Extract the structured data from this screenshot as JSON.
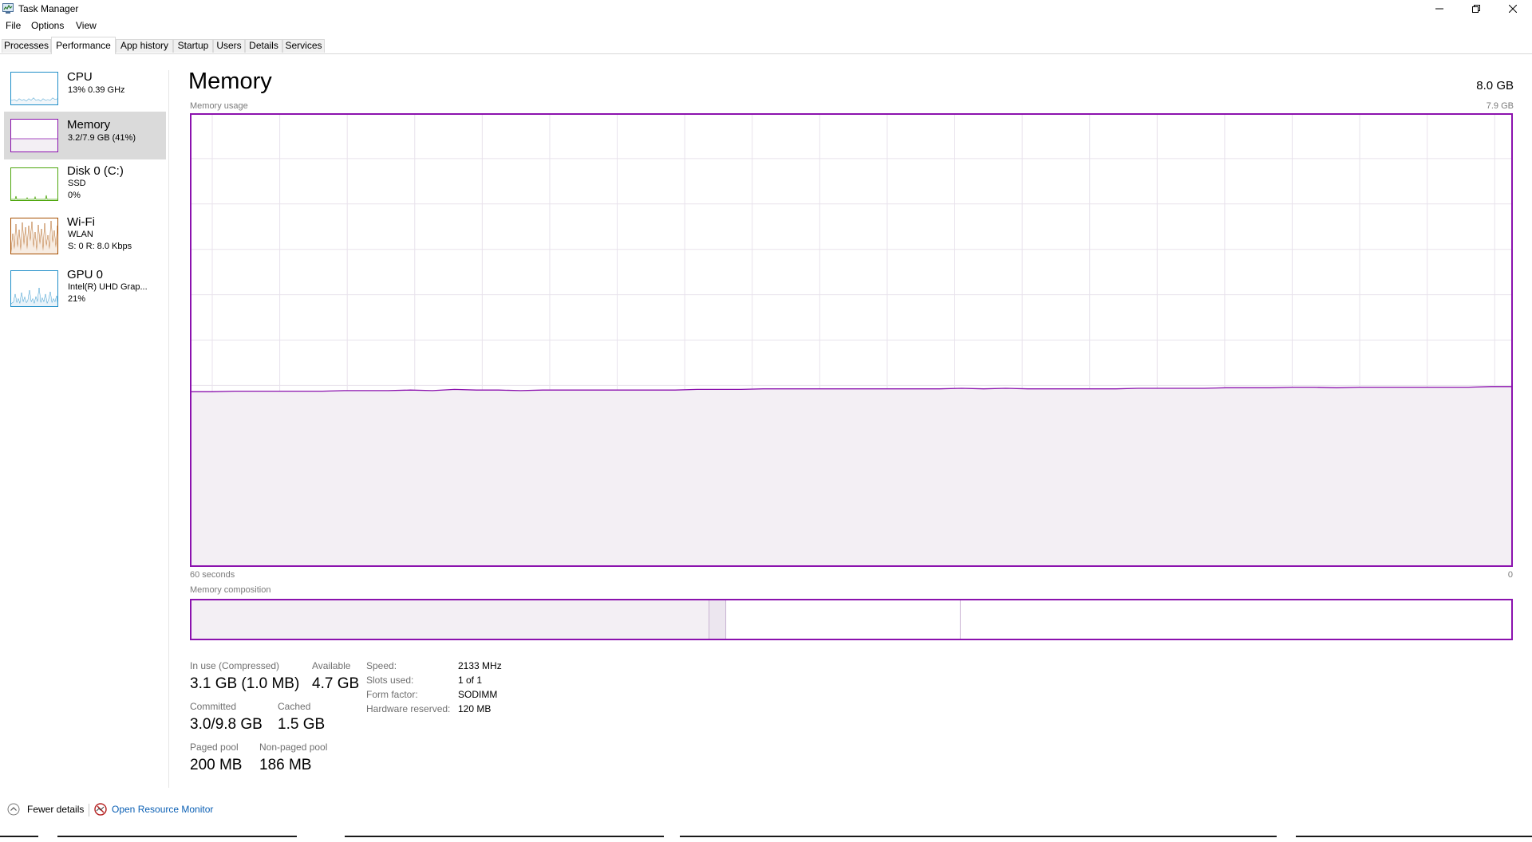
{
  "window": {
    "title": "Task Manager"
  },
  "menu": [
    "File",
    "Options",
    "View"
  ],
  "tabs": [
    {
      "label": "Processes",
      "active": false
    },
    {
      "label": "Performance",
      "active": true
    },
    {
      "label": "App history",
      "active": false
    },
    {
      "label": "Startup",
      "active": false
    },
    {
      "label": "Users",
      "active": false
    },
    {
      "label": "Details",
      "active": false
    },
    {
      "label": "Services",
      "active": false
    }
  ],
  "sidebar": {
    "items": [
      {
        "title": "CPU",
        "lines": [
          "13%  0.39 GHz"
        ],
        "color": "#1f8ec8",
        "selected": false
      },
      {
        "title": "Memory",
        "lines": [
          "3.2/7.9 GB (41%)"
        ],
        "color": "#8b12ae",
        "selected": true
      },
      {
        "title": "Disk 0 (C:)",
        "lines": [
          "SSD",
          "0%"
        ],
        "color": "#4da60c",
        "selected": false
      },
      {
        "title": "Wi-Fi",
        "lines": [
          "WLAN",
          "S: 0  R: 8.0 Kbps"
        ],
        "color": "#a74f01",
        "selected": false
      },
      {
        "title": "GPU 0",
        "lines": [
          "Intel(R) UHD Grap...",
          "21%"
        ],
        "color": "#1f8ec8",
        "selected": false
      }
    ]
  },
  "main": {
    "title": "Memory",
    "total": "8.0 GB",
    "usage_label": "Memory usage",
    "usage_max": "7.9 GB",
    "axis_left": "60 seconds",
    "axis_right": "0",
    "composition_label": "Memory composition"
  },
  "chart_data": {
    "type": "area",
    "title": "Memory usage",
    "xlabel": "60 seconds",
    "ylabel": "",
    "x": [
      60,
      59,
      58,
      57,
      56,
      55,
      54,
      53,
      52,
      51,
      50,
      49,
      48,
      47,
      46,
      45,
      44,
      43,
      42,
      41,
      40,
      39,
      38,
      37,
      36,
      35,
      34,
      33,
      32,
      31,
      30,
      29,
      28,
      27,
      26,
      25,
      24,
      23,
      22,
      21,
      20,
      19,
      18,
      17,
      16,
      15,
      14,
      13,
      12,
      11,
      10,
      9,
      8,
      7,
      6,
      5,
      4,
      3,
      2,
      1,
      0
    ],
    "series": [
      {
        "values": [
          3.05,
          3.05,
          3.06,
          3.06,
          3.06,
          3.06,
          3.06,
          3.07,
          3.07,
          3.07,
          3.08,
          3.07,
          3.09,
          3.08,
          3.08,
          3.07,
          3.08,
          3.08,
          3.08,
          3.08,
          3.08,
          3.08,
          3.08,
          3.09,
          3.09,
          3.09,
          3.1,
          3.1,
          3.1,
          3.1,
          3.1,
          3.1,
          3.1,
          3.1,
          3.1,
          3.11,
          3.1,
          3.11,
          3.1,
          3.1,
          3.1,
          3.1,
          3.1,
          3.11,
          3.11,
          3.11,
          3.11,
          3.12,
          3.12,
          3.12,
          3.13,
          3.13,
          3.12,
          3.13,
          3.13,
          3.13,
          3.13,
          3.13,
          3.13,
          3.14,
          3.14
        ]
      }
    ],
    "ylim": [
      0,
      7.9
    ],
    "xlim": [
      60,
      0
    ],
    "unit": "GB",
    "grid": true,
    "color": "#8b12ae",
    "fill": "#f3eff4"
  },
  "composition": {
    "segments": [
      {
        "gb": 3.1,
        "fill": "#f3eff4"
      },
      {
        "gb": 0.1,
        "fill": "#ece6ef"
      },
      {
        "gb": 1.4,
        "fill": "#ffffff"
      },
      {
        "gb": 3.3,
        "fill": "#ffffff"
      }
    ],
    "total_gb": 7.9
  },
  "stats": {
    "in_use_label": "In use (Compressed)",
    "in_use_value": "3.1 GB (1.0 MB)",
    "available_label": "Available",
    "available_value": "4.7 GB",
    "committed_label": "Committed",
    "committed_value": "3.0/9.8 GB",
    "cached_label": "Cached",
    "cached_value": "1.5 GB",
    "paged_label": "Paged pool",
    "paged_value": "200 MB",
    "nonpaged_label": "Non-paged pool",
    "nonpaged_value": "186 MB"
  },
  "specs": [
    {
      "label": "Speed:",
      "value": "2133 MHz"
    },
    {
      "label": "Slots used:",
      "value": "1 of 1"
    },
    {
      "label": "Form factor:",
      "value": "SODIMM"
    },
    {
      "label": "Hardware reserved:",
      "value": "120 MB"
    }
  ],
  "footer": {
    "fewer_details": "Fewer details",
    "resource_monitor": "Open Resource Monitor"
  },
  "colors": {
    "memory_accent": "#8b12ae",
    "link": "#0a5fb4",
    "selected_bg": "#dadada"
  }
}
